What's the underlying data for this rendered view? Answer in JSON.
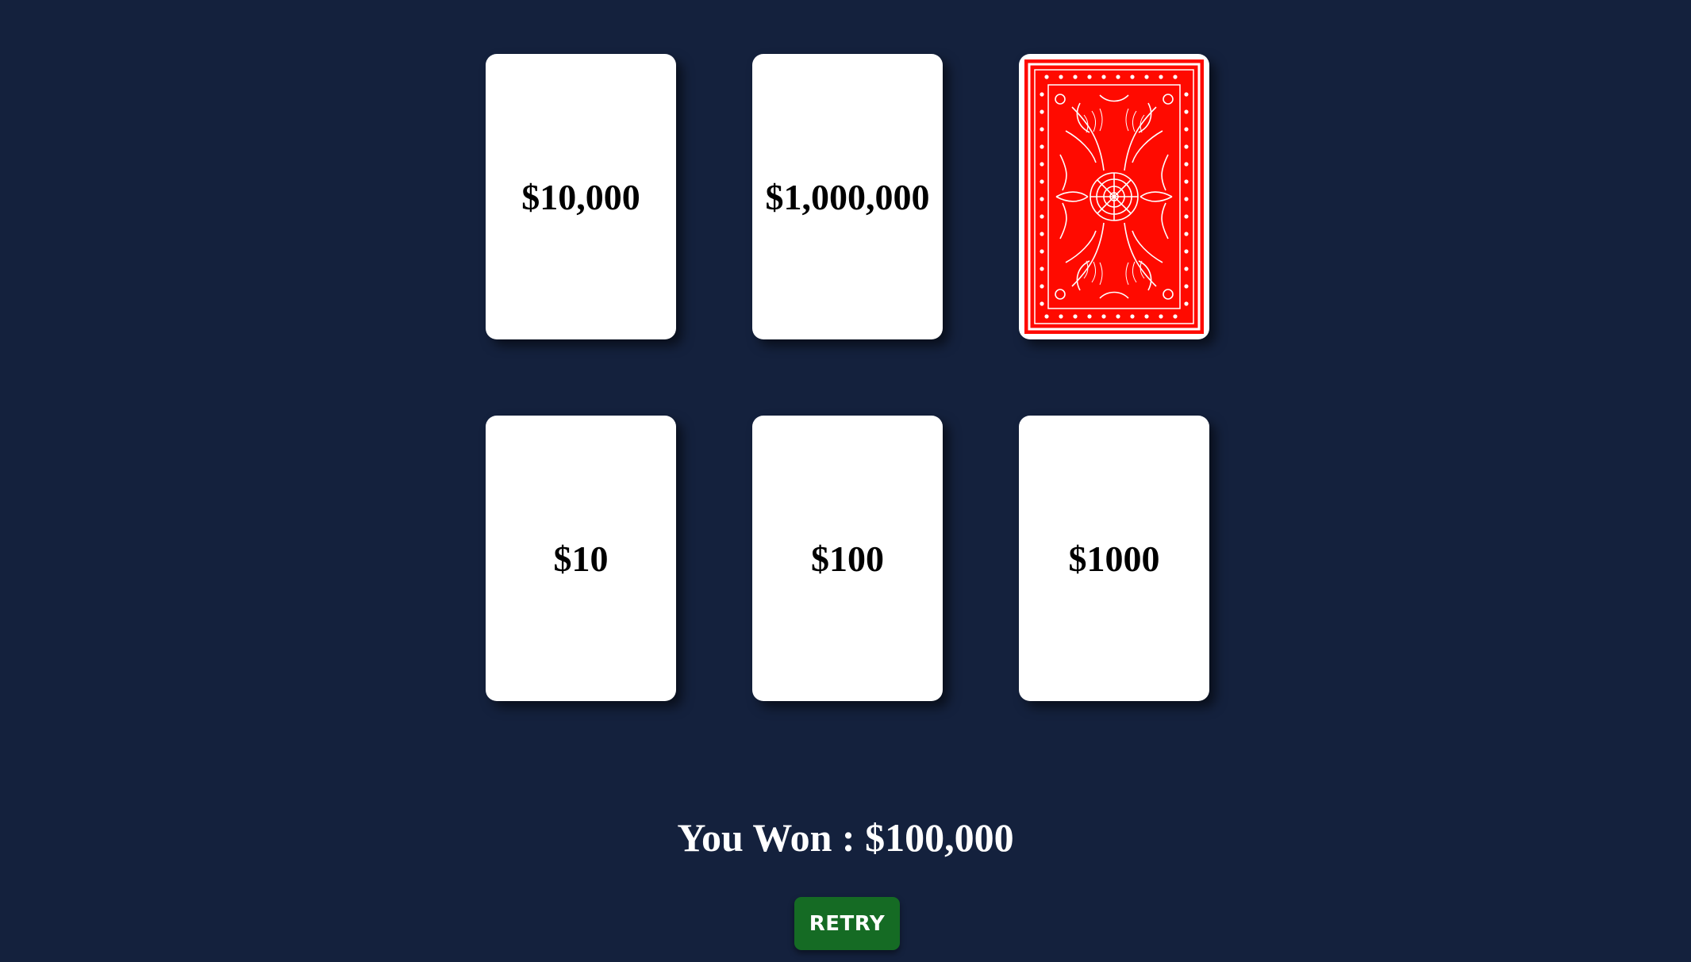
{
  "cards": [
    {
      "state": "face-up",
      "value": "$10,000"
    },
    {
      "state": "face-up",
      "value": "$1,000,000"
    },
    {
      "state": "face-down",
      "back_icon": "card-back-pattern-icon",
      "back_color": "#ff0a00"
    },
    {
      "state": "face-up",
      "value": "$10"
    },
    {
      "state": "face-up",
      "value": "$100"
    },
    {
      "state": "face-up",
      "value": "$1000"
    }
  ],
  "result": {
    "text": "You Won : $100,000"
  },
  "retry_button": {
    "label": "RETRY",
    "color": "#156b24"
  },
  "colors": {
    "background": "#14213d",
    "card_face": "#ffffff"
  }
}
